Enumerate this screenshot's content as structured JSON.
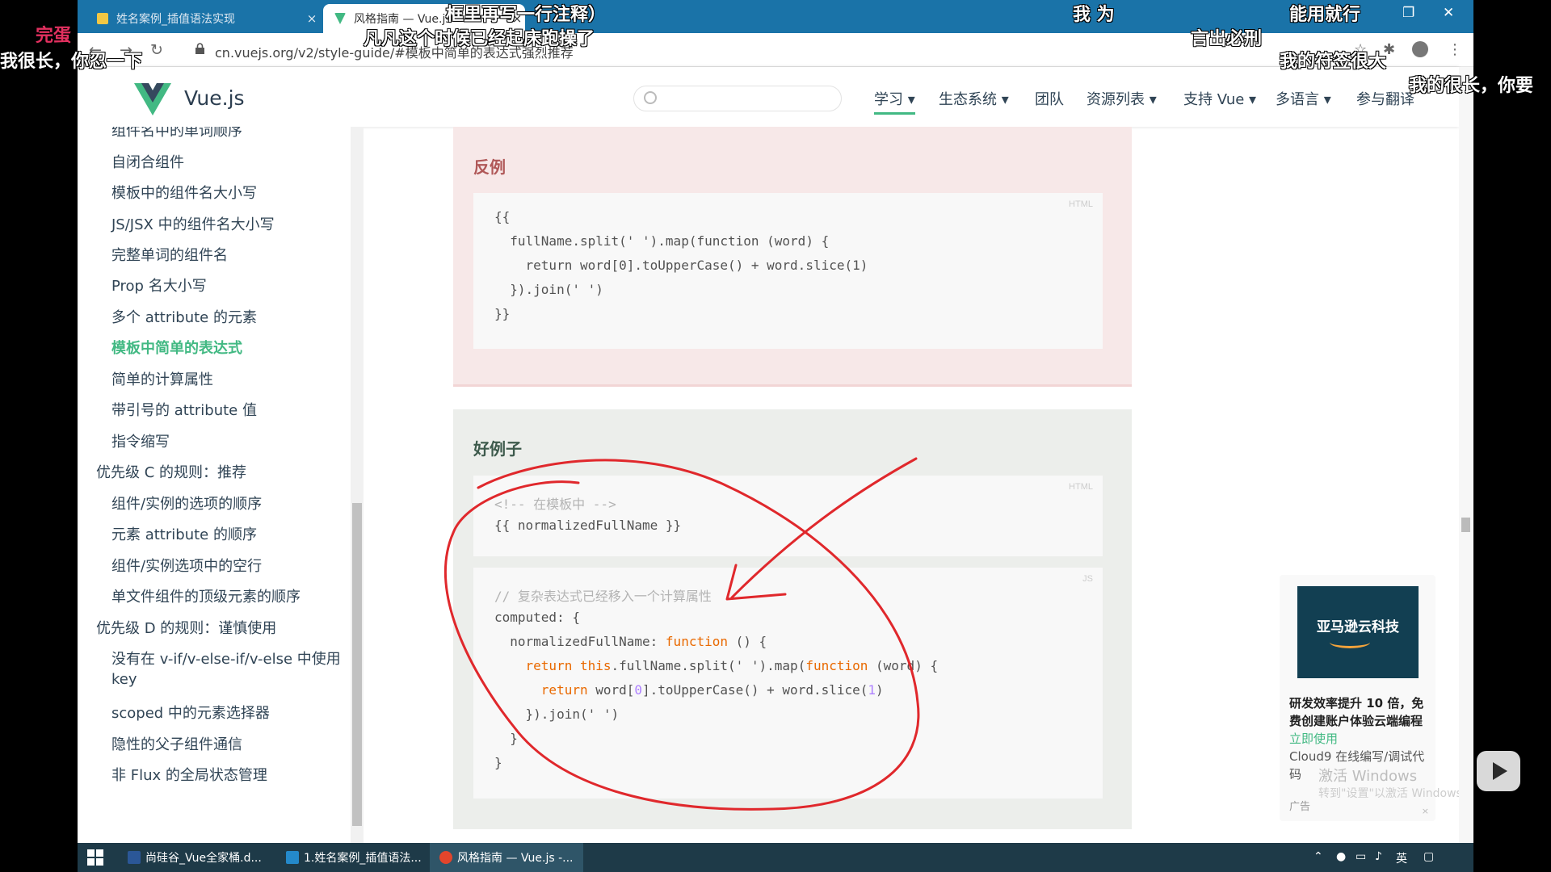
{
  "browser": {
    "tabs": [
      {
        "title": "姓名案例_插值语法实现",
        "close": "×"
      },
      {
        "title": "风格指南 — Vue.js",
        "close": "×"
      }
    ],
    "url": "cn.vuejs.org/v2/style-guide/#模板中简单的表达式强烈推荐",
    "window_controls": {
      "restore": "❐",
      "close": "✕"
    },
    "nav": {
      "back": "←",
      "forward": "→",
      "reload": "↻"
    }
  },
  "site": {
    "brand": "Vue.js",
    "search_placeholder": "",
    "nav": [
      {
        "label": "学习 ▾"
      },
      {
        "label": "生态系统 ▾"
      },
      {
        "label": "团队"
      },
      {
        "label": "资源列表 ▾"
      },
      {
        "label": "支持 Vue ▾"
      },
      {
        "label": "多语言 ▾"
      },
      {
        "label": "参与翻译"
      }
    ]
  },
  "sidebar": {
    "items": [
      {
        "label": "组件名中的单词顺序"
      },
      {
        "label": "自闭合组件"
      },
      {
        "label": "模板中的组件名大小写"
      },
      {
        "label": "JS/JSX 中的组件名大小写"
      },
      {
        "label": "完整单词的组件名"
      },
      {
        "label": "Prop 名大小写"
      },
      {
        "label": "多个 attribute 的元素"
      },
      {
        "label": "模板中简单的表达式"
      },
      {
        "label": "简单的计算属性"
      },
      {
        "label": "带引号的 attribute 值"
      },
      {
        "label": "指令缩写"
      },
      {
        "label": "优先级 C 的规则：推荐"
      },
      {
        "label": "组件/实例的选项的顺序"
      },
      {
        "label": "元素 attribute 的顺序"
      },
      {
        "label": "组件/实例选项中的空行"
      },
      {
        "label": "单文件组件的顶级元素的顺序"
      },
      {
        "label": "优先级 D 的规则：谨慎使用"
      },
      {
        "label": "没有在 v-if/v-else-if/v-else 中使用"
      },
      {
        "label": "key"
      },
      {
        "label": "scoped 中的元素选择器"
      },
      {
        "label": "隐性的父子组件通信"
      },
      {
        "label": "非 Flux 的全局状态管理"
      }
    ]
  },
  "bad_example": {
    "label": "反例",
    "lang": "HTML",
    "lines": [
      "{{",
      "  fullName.split(' ').map(function (word) {",
      "    return word[0].toUpperCase() + word.slice(1)",
      "  }).join(' ')",
      "}}"
    ]
  },
  "good_example": {
    "label": "好例子",
    "html_block": {
      "lang": "HTML",
      "comment": "<!-- 在模板中 -->",
      "line": "{{ normalizedFullName }}"
    },
    "js_block": {
      "lang": "JS",
      "comment": "// 复杂表达式已经移入一个计算属性",
      "l1": "computed: {",
      "l2a": "  normalizedFullName: ",
      "l2kw": "function",
      "l2b": " () {",
      "l3kw": "    return this",
      "l3b": ".fullName.split(' ').map(",
      "l3kw2": "function",
      "l3c": " (word) {",
      "l4kw": "      return",
      "l4a": " word[",
      "l4n": "0",
      "l4b": "].toUpperCase() + word.slice(",
      "l4n2": "1",
      "l4c": ")",
      "l5": "    }).join(' ')",
      "l6": "  }",
      "l7": "}"
    }
  },
  "ad": {
    "image_text": "亚马逊云科技",
    "headline": "研发效率提升 10 倍，免费创建账户体验云端编程",
    "cta": "立即使用",
    "body": "Cloud9 在线编写/调试代码",
    "label": "广告",
    "close": "×"
  },
  "watermark": {
    "line1": "激活 Windows",
    "line2": "转到\"设置\"以激活 Windows。"
  },
  "taskbar": {
    "items": [
      {
        "label": "尚硅谷_Vue全家桶.d..."
      },
      {
        "label": "1.姓名案例_插值语法..."
      },
      {
        "label": "风格指南 — Vue.js -..."
      }
    ],
    "ime": "英"
  },
  "danmaku": [
    {
      "text": "完蛋"
    },
    {
      "text": "我很长，你忍一下"
    },
    {
      "text": "框里再写一行注释）"
    },
    {
      "text": "凡凡这个时候已经起床跑操了"
    },
    {
      "text": "我 为"
    },
    {
      "text": "言出必刑"
    },
    {
      "text": "能用就行"
    },
    {
      "text": "我的符签很大"
    },
    {
      "text": "我的很长，你要"
    }
  ],
  "colors": {
    "vue_green": "#42b983",
    "bad_bg": "#f7e8e8",
    "good_bg": "#eceeeb",
    "annotation_red": "#e0282c",
    "chrome_blue": "#1a73a8"
  }
}
